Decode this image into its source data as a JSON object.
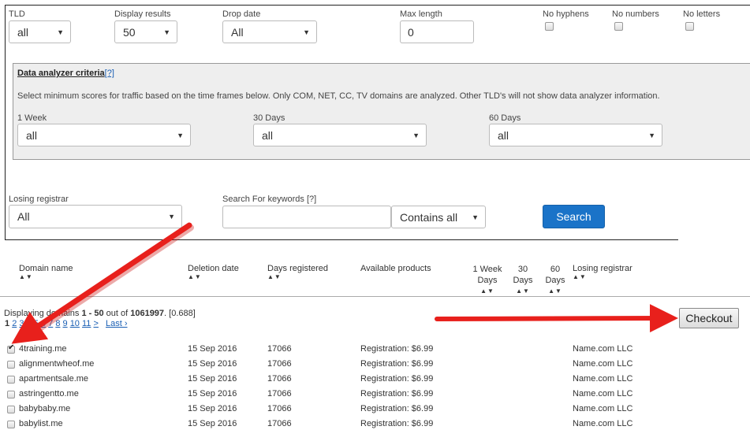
{
  "filters": {
    "tld": {
      "label": "TLD",
      "value": "all"
    },
    "display_results": {
      "label": "Display results",
      "value": "50"
    },
    "drop_date": {
      "label": "Drop date",
      "value": "All"
    },
    "max_length": {
      "label": "Max length",
      "value": "0"
    },
    "no_hyphens": {
      "label": "No hyphens",
      "checked": false
    },
    "no_numbers": {
      "label": "No numbers",
      "checked": false
    },
    "no_letters": {
      "label": "No letters",
      "checked": false
    }
  },
  "analyzer": {
    "title": "Data analyzer criteria",
    "help": "[?]",
    "description": "Select minimum scores for traffic based on the time frames below. Only COM, NET, CC, TV domains are analyzed. Other TLD's will not show data analyzer information.",
    "week1": {
      "label": "1 Week",
      "value": "all"
    },
    "days30": {
      "label": "30 Days",
      "value": "all"
    },
    "days60": {
      "label": "60 Days",
      "value": "all"
    }
  },
  "search": {
    "losing_registrar": {
      "label": "Losing registrar",
      "value": "All"
    },
    "keywords_label": "Search For keywords [?]",
    "keywords_value": "",
    "match_mode": "Contains all",
    "button": "Search"
  },
  "table": {
    "headers": {
      "domain": "Domain name",
      "deletion": "Deletion date",
      "days_registered": "Days registered",
      "products": "Available products",
      "week1": [
        "1 Week",
        "Days"
      ],
      "days30": [
        "30",
        "Days"
      ],
      "days60": [
        "60",
        "Days"
      ],
      "registrar": "Losing registrar",
      "sort_arrows": "▲▼"
    },
    "summary": {
      "prefix": "Displaying domains ",
      "range": "1 - 50",
      "middle": " out of ",
      "total": "1061997",
      "suffix": ". [0.688]"
    },
    "pages": [
      "1",
      "2",
      "3",
      "4",
      "5",
      "6",
      "7",
      "8",
      "9",
      "10",
      "11"
    ],
    "next": ">",
    "last": "Last ›",
    "checkout": "Checkout",
    "rows": [
      {
        "domain": "4training.me",
        "date": "15 Sep 2016",
        "days": "17066",
        "product": "Registration: $6.99",
        "registrar": "Name.com LLC",
        "checked": true
      },
      {
        "domain": "alignmentwheof.me",
        "date": "15 Sep 2016",
        "days": "17066",
        "product": "Registration: $6.99",
        "registrar": "Name.com LLC",
        "checked": false
      },
      {
        "domain": "apartmentsale.me",
        "date": "15 Sep 2016",
        "days": "17066",
        "product": "Registration: $6.99",
        "registrar": "Name.com LLC",
        "checked": false
      },
      {
        "domain": "astringentto.me",
        "date": "15 Sep 2016",
        "days": "17066",
        "product": "Registration: $6.99",
        "registrar": "Name.com LLC",
        "checked": false
      },
      {
        "domain": "babybaby.me",
        "date": "15 Sep 2016",
        "days": "17066",
        "product": "Registration: $6.99",
        "registrar": "Name.com LLC",
        "checked": false
      },
      {
        "domain": "babylist.me",
        "date": "15 Sep 2016",
        "days": "17066",
        "product": "Registration: $6.99",
        "registrar": "Name.com LLC",
        "checked": false
      }
    ]
  },
  "colors": {
    "accent": "#1a73c8",
    "annotation_arrow": "#e8201c"
  }
}
